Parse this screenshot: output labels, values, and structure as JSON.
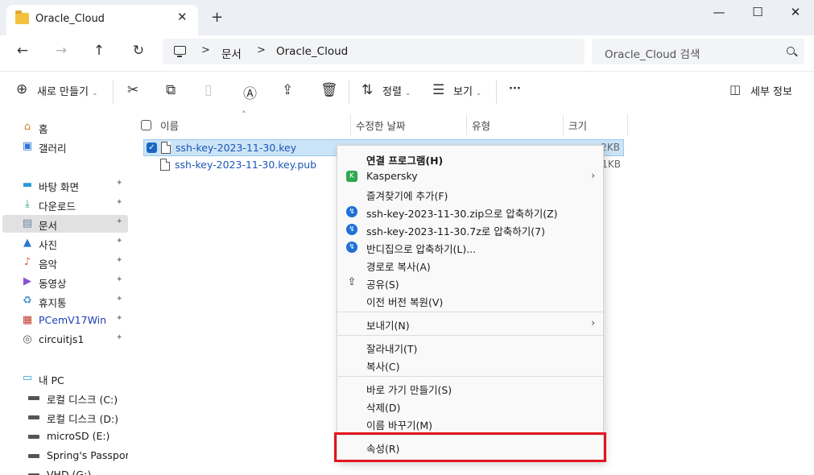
{
  "window": {
    "tab_title": "Oracle_Cloud",
    "tab_close": "✕",
    "new_tab": "+",
    "minimize": "—",
    "maximize": "☐",
    "close": "✕"
  },
  "nav": {
    "back": "←",
    "forward": "→",
    "up": "↑",
    "refresh": "↻",
    "breadcrumb": [
      "문서",
      "Oracle_Cloud"
    ],
    "separator": ">",
    "search_placeholder": "Oracle_Cloud 검색"
  },
  "commandbar": {
    "new_label": "새로 만들기",
    "sort_label": "정렬",
    "view_label": "보기",
    "more": "···",
    "details_label": "세부 정보"
  },
  "sidebar": {
    "items": [
      {
        "label": "홈",
        "icon": "home-icon",
        "glyph": "⌂"
      },
      {
        "label": "갤러리",
        "icon": "gallery-icon",
        "glyph": "▣"
      },
      {
        "label": "바탕 화면",
        "icon": "desktop-icon",
        "glyph": "▬",
        "pinned": true
      },
      {
        "label": "다운로드",
        "icon": "download-icon",
        "glyph": "⤓",
        "pinned": true
      },
      {
        "label": "문서",
        "icon": "documents-icon",
        "glyph": "▤",
        "pinned": true,
        "selected": true
      },
      {
        "label": "사진",
        "icon": "pictures-icon",
        "glyph": "▲",
        "pinned": true
      },
      {
        "label": "음악",
        "icon": "music-icon",
        "glyph": "♪",
        "pinned": true
      },
      {
        "label": "동영상",
        "icon": "videos-icon",
        "glyph": "▶",
        "pinned": true
      },
      {
        "label": "휴지통",
        "icon": "recycle-bin-icon",
        "glyph": "♻",
        "pinned": true
      },
      {
        "label": "PCemV17Win",
        "icon": "pcem-icon",
        "glyph": "▦",
        "pinned": true
      },
      {
        "label": "circuitjs1",
        "icon": "circuitjs-icon",
        "glyph": "◎",
        "pinned": true
      }
    ],
    "this_pc": {
      "label": "내 PC",
      "icon": "pc-icon",
      "glyph": "▭"
    },
    "drives": [
      {
        "label": "로컬 디스크 (C:)"
      },
      {
        "label": "로컬 디스크 (D:)"
      },
      {
        "label": "microSD (E:)"
      },
      {
        "label": "Spring's Passport (F"
      },
      {
        "label": "VHD (G:)"
      }
    ],
    "pin_glyph": "📌"
  },
  "filelist": {
    "columns": [
      "이름",
      "수정한 날짜",
      "유형",
      "크기"
    ],
    "sort_indicator": "˄",
    "files": [
      {
        "name": "ssh-key-2023-11-30.key",
        "size": "2KB",
        "selected": true
      },
      {
        "name": "ssh-key-2023-11-30.key.pub",
        "size": "1KB",
        "selected": false
      }
    ]
  },
  "context_menu": {
    "items": [
      {
        "label": "연결 프로그램(H)",
        "bold": true
      },
      {
        "label": "Kaspersky",
        "icon": "kaspersky-icon",
        "submenu": true
      },
      {
        "label": "즐겨찾기에 추가(F)"
      },
      {
        "label": "ssh-key-2023-11-30.zip으로 압축하기(Z)",
        "icon": "bandizip-icon"
      },
      {
        "label": "ssh-key-2023-11-30.7z로 압축하기(7)",
        "icon": "bandizip-icon"
      },
      {
        "label": "반디집으로 압축하기(L)...",
        "icon": "bandizip-icon"
      },
      {
        "label": "경로로 복사(A)"
      },
      {
        "label": "공유(S)",
        "icon": "share-icon"
      },
      {
        "label": "이전 버전 복원(V)"
      },
      {
        "label": "보내기(N)",
        "submenu": true
      },
      {
        "label": "잘라내기(T)"
      },
      {
        "label": "복사(C)"
      },
      {
        "label": "바로 가기 만들기(S)"
      },
      {
        "label": "삭제(D)"
      },
      {
        "label": "이름 바꾸기(M)"
      },
      {
        "label": "속성(R)"
      }
    ],
    "submenu_arrow": "›"
  },
  "colors": {
    "highlight": "#e1161f",
    "selection": "#cce4f7",
    "link": "#1b56b8",
    "kaspersky": "#2fa84f",
    "bandizip": "#1e6fd9"
  }
}
